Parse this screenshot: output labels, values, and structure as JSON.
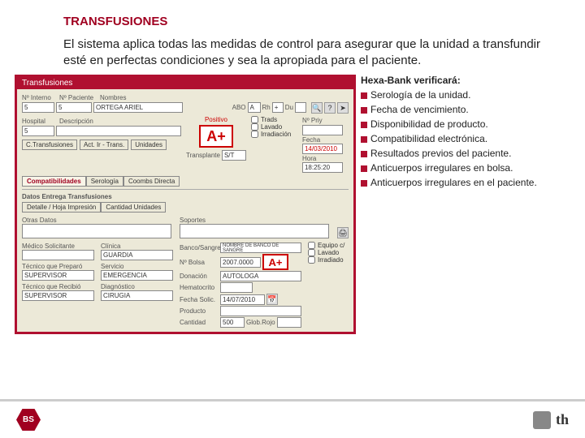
{
  "title": "TRANSFUSIONES",
  "desc": "El sistema aplica todas las medidas de control para asegurar que la unidad a transfundir esté en perfectas condiciones y sea la apropiada para el paciente.",
  "app": {
    "winTitle": "Transfusiones",
    "lblInterno": "Nº Interno",
    "lblPaciente": "Nº Paciente",
    "lblNombre": "Nombres",
    "vInterno": "5",
    "vPaciente": "5",
    "vNombre": "ORTEGA ARIEL",
    "lblABO": "ABO",
    "vABO": "A",
    "lblRh": "Rh",
    "vRh": "+",
    "lblDu": "Du",
    "positivo": "Positivo",
    "blood": "A+",
    "lblHosp": "Hospital",
    "lblDescr": "Descripción",
    "vHosp": "5",
    "lblPrity": "Nº Priy",
    "lblFecha": "Fecha",
    "vFecha": "14/03/2010",
    "lblHora": "Hora",
    "vHora": "18:25:20",
    "btnCTrans": "C.Transfusiones",
    "btnActTrans": "Act. Ir - Trans.",
    "btnUnidades": "Unidades",
    "chkTrads": "Trads",
    "chkLavado": "Lavado",
    "chkIrrad": "Irradiación",
    "lblTransplante": "Transplante",
    "vTransplante": "S/T",
    "tab1": "Compatibilidades",
    "tab2": "Serología",
    "tab3": "Coombs Directa",
    "subhead": "Datos Entrega Transfusiones",
    "subtab1": "Detalle / Hoja Impresión",
    "subtab2": "Cantidad Unidades",
    "lblOtras": "Otras Datos",
    "lblSoportes": "Soportes",
    "lblMedico": "Médico Solicitante",
    "lblClinica": "Clínica",
    "vClinica": "GUARDIA",
    "lblBanco": "Banco/Sangre",
    "vBanco": "NOMBRE DE BANCO DE SANGRE",
    "lblBolsa": "Nº Bolsa",
    "vBolsa": "2007.0000",
    "blood2": "A+",
    "lblDonacion": "Donación",
    "vDonacion": "AUTOLOGA",
    "chkEq": "Equipo c/",
    "chkLav2": "Lavado",
    "chkIrr2": "Irradiado",
    "lblTecPrep": "Técnico que Preparó",
    "vTecPrep": "SUPERVISOR",
    "lblServicio": "Servicio",
    "vServicio": "EMERGENCIA",
    "lblHemat": "Hematocrito",
    "lblFechaSol": "Fecha Solic.",
    "vFechaSol": "14/07/2010",
    "lblTecRec": "Técnico que Recibió",
    "vTecRec": "SUPERVISOR",
    "lblDiag": "Diagnóstico",
    "vDiag": "CIRUGIA",
    "lblProducto": "Producto",
    "lblCantidad": "Cantidad",
    "vCantidad": "500",
    "lblGlobRojo": "Glob.Rojo",
    "q": "?"
  },
  "side": {
    "head": "Hexa-Bank verificará:",
    "i1": "Serología de la unidad.",
    "i2": "Fecha de vencimiento.",
    "i3": "Disponibilidad de producto.",
    "i4": "Compatibilidad electrónica.",
    "i5": "Resultados previos del paciente.",
    "i6": "Anticuerpos irregulares en bolsa.",
    "i7": "Anticuerpos irregulares en el paciente."
  },
  "footer": {
    "hex": "BS",
    "th": "th"
  }
}
